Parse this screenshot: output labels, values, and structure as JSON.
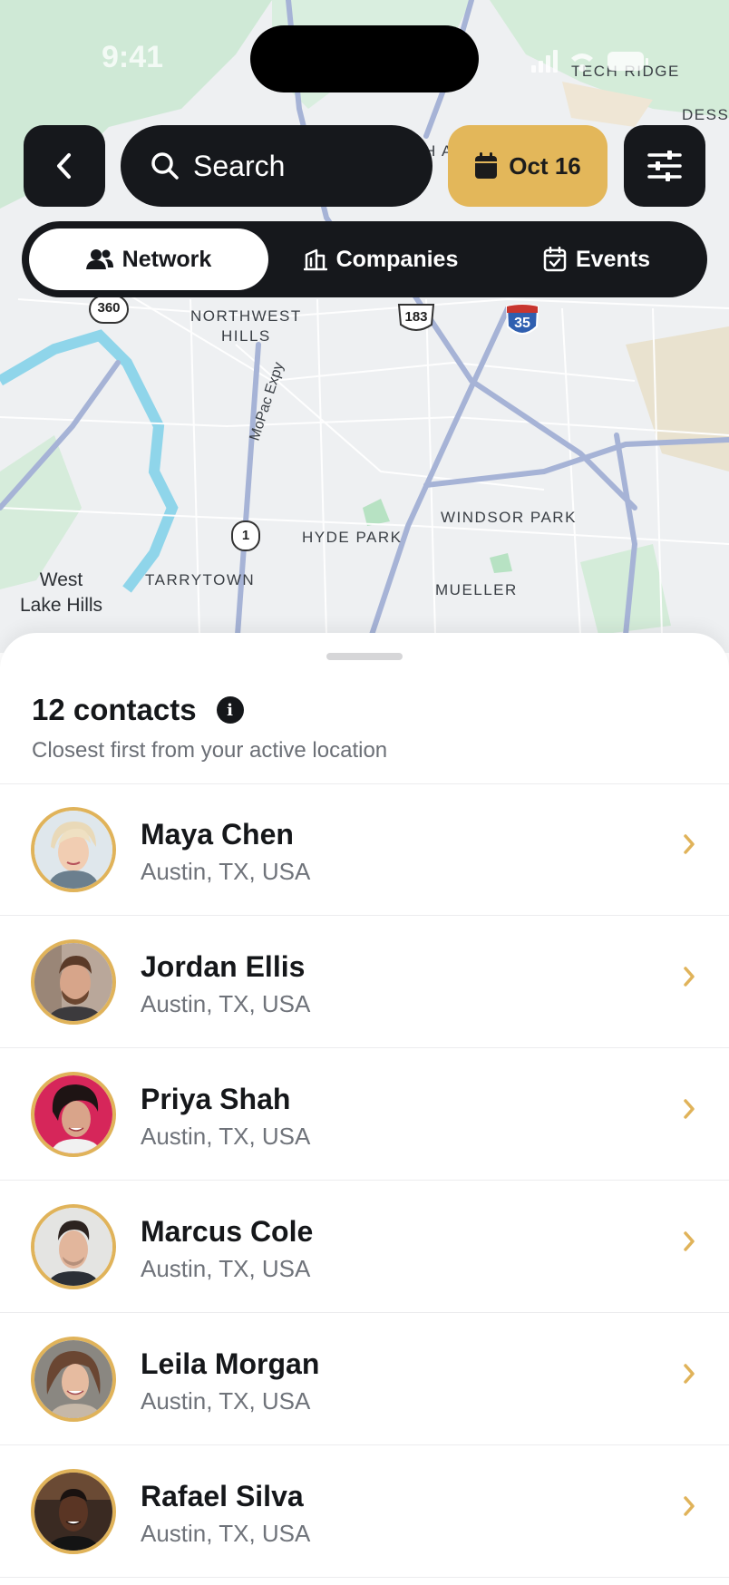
{
  "status_bar": {
    "time": "9:41"
  },
  "map": {
    "labels": {
      "tech_ridge": "TECH RIDGE",
      "dess": "DESS",
      "northwest_hills": "NORTHWEST\nHILLS",
      "mopac": "MoPac Expy",
      "hyde_park": "HYDE PARK",
      "windsor_park": "WINDSOR PARK",
      "tarrytown": "TARRYTOWN",
      "mueller": "MUELLER",
      "west_lake_hills": "West\nLake Hills",
      "partial_label": "H A"
    },
    "route_badges": {
      "r360": "360",
      "r183": "183",
      "r35": "35",
      "r1": "1"
    }
  },
  "controls": {
    "search_placeholder": "Search",
    "date_label": "Oct 16",
    "accent_color": "#e3b75a",
    "icons": {
      "back": "chevron-left-icon",
      "search": "search-icon",
      "calendar": "calendar-icon",
      "filter": "sliders-icon"
    }
  },
  "segments": [
    {
      "label": "Network",
      "icon": "people-icon",
      "active": true
    },
    {
      "label": "Companies",
      "icon": "building-icon",
      "active": false
    },
    {
      "label": "Events",
      "icon": "calendar-check-icon",
      "active": false
    }
  ],
  "sheet": {
    "title": "12 contacts",
    "subtitle": "Closest first from your active location"
  },
  "contacts": [
    {
      "name": "Maya Chen",
      "location": "Austin, TX, USA"
    },
    {
      "name": "Jordan Ellis",
      "location": "Austin, TX, USA"
    },
    {
      "name": "Priya Shah",
      "location": "Austin, TX, USA"
    },
    {
      "name": "Marcus Cole",
      "location": "Austin, TX, USA"
    },
    {
      "name": "Leila Morgan",
      "location": "Austin, TX, USA"
    },
    {
      "name": "Rafael Silva",
      "location": "Austin, TX, USA"
    }
  ]
}
